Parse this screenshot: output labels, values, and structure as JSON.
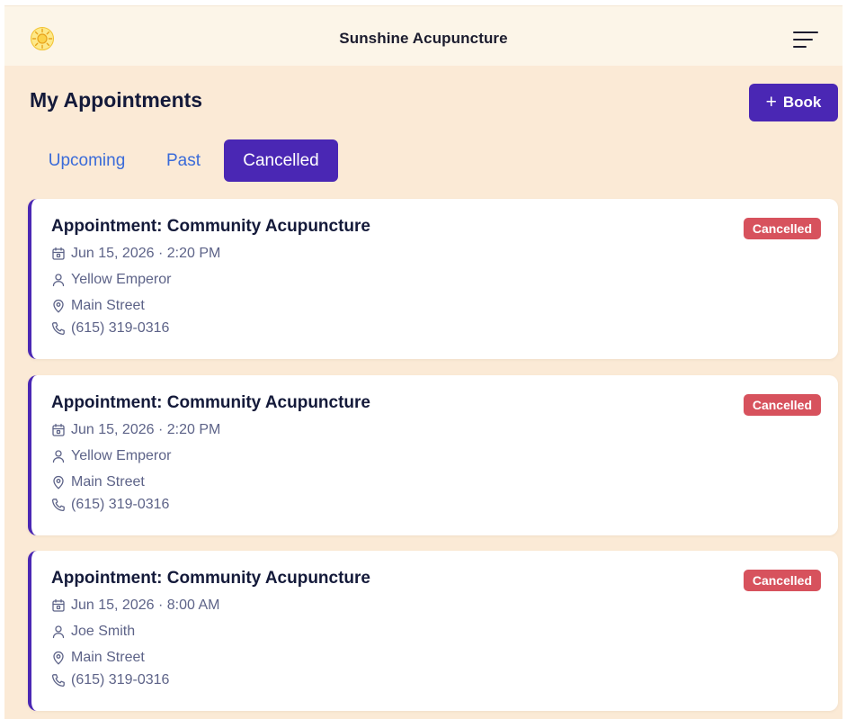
{
  "header": {
    "app_title": "Sunshine Acupuncture",
    "logo_icon": "sun-icon",
    "menu_icon": "menu-icon"
  },
  "page": {
    "title": "My Appointments",
    "book_button": {
      "icon": "plus-icon",
      "label": "Book"
    }
  },
  "tabs": [
    {
      "label": "Upcoming",
      "active": false
    },
    {
      "label": "Past",
      "active": false
    },
    {
      "label": "Cancelled",
      "active": true
    }
  ],
  "appointments": [
    {
      "title": "Appointment: Community Acupuncture",
      "status": "Cancelled",
      "datetime": "Jun 15, 2026 · 2:20 PM",
      "practitioner": "Yellow Emperor",
      "location": "Main Street",
      "phone": "(615) 319-0316"
    },
    {
      "title": "Appointment: Community Acupuncture",
      "status": "Cancelled",
      "datetime": "Jun 15, 2026 · 2:20 PM",
      "practitioner": "Yellow Emperor",
      "location": "Main Street",
      "phone": "(615) 319-0316"
    },
    {
      "title": "Appointment: Community Acupuncture",
      "status": "Cancelled",
      "datetime": "Jun 15, 2026 · 8:00 AM",
      "practitioner": "Joe Smith",
      "location": "Main Street",
      "phone": "(615) 319-0316"
    }
  ],
  "colors": {
    "background": "#fbead6",
    "header_background": "#fcf5e8",
    "accent": "#4a27b4",
    "tab_link": "#3a6bd9",
    "cancelled_badge": "#d7525d"
  }
}
